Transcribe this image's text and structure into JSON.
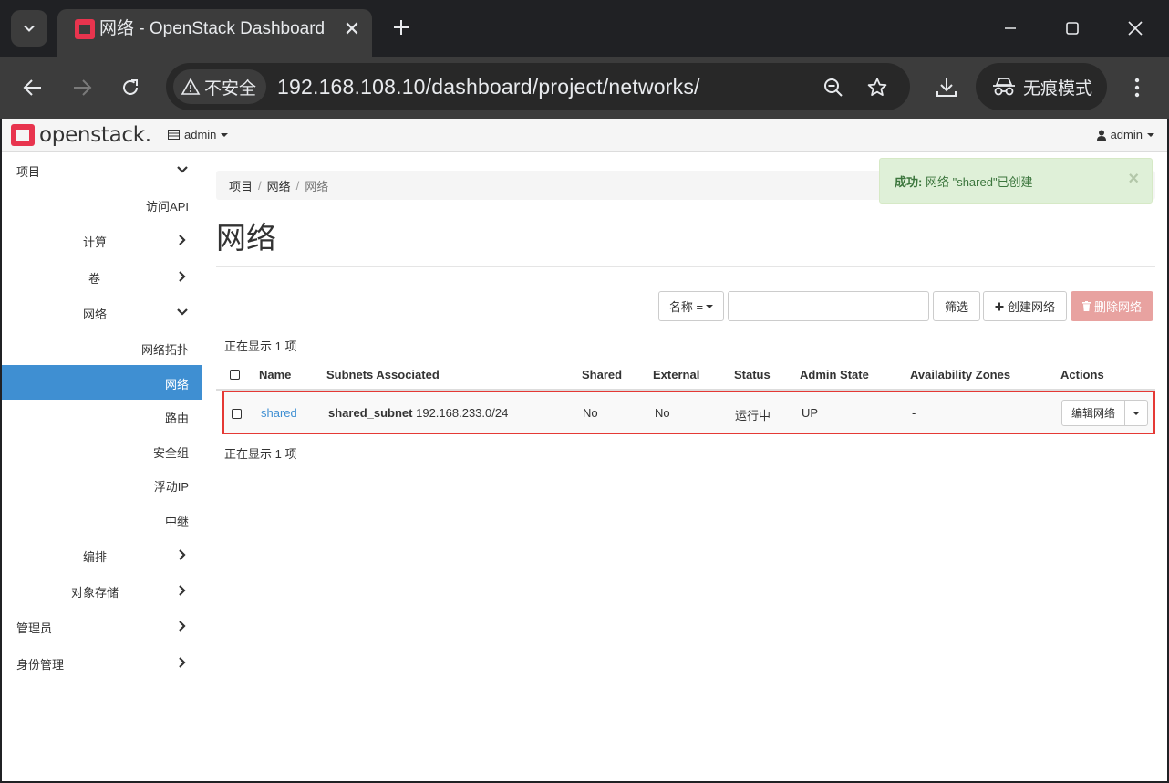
{
  "browser": {
    "tab_title": "网络 - OpenStack Dashboard",
    "security_label": "不安全",
    "url": "192.168.108.10/dashboard/project/networks/",
    "incognito_label": "无痕模式"
  },
  "navbar": {
    "logo_text": "openstack.",
    "project": "admin",
    "user": "admin"
  },
  "sidebar": {
    "items": [
      {
        "label": "项目",
        "level": 0,
        "chevron": "down"
      },
      {
        "label": "访问API",
        "level": 2
      },
      {
        "label": "计算",
        "level": 1,
        "chevron": "right"
      },
      {
        "label": "卷",
        "level": 1,
        "chevron": "right"
      },
      {
        "label": "网络",
        "level": 1,
        "chevron": "down"
      },
      {
        "label": "网络拓扑",
        "level": 2
      },
      {
        "label": "网络",
        "level": 2,
        "active": true
      },
      {
        "label": "路由",
        "level": 2
      },
      {
        "label": "安全组",
        "level": 2
      },
      {
        "label": "浮动IP",
        "level": 2
      },
      {
        "label": "中继",
        "level": 2
      },
      {
        "label": "编排",
        "level": 1,
        "chevron": "right"
      },
      {
        "label": "对象存储",
        "level": 1,
        "chevron": "right"
      },
      {
        "label": "管理员",
        "level": 0,
        "chevron": "right"
      },
      {
        "label": "身份管理",
        "level": 0,
        "chevron": "right"
      }
    ]
  },
  "breadcrumb": [
    "项目",
    "网络",
    "网络"
  ],
  "alert": {
    "strong": "成功:",
    "message": "网络 \"shared\"已创建",
    "close": "×"
  },
  "page_title": "网络",
  "filter": {
    "field_label": "名称 =",
    "input_value": "",
    "filter_button": "筛选",
    "create_button": "创建网络",
    "delete_button": "删除网络"
  },
  "count_text_top": "正在显示 1 项",
  "count_text_bottom": "正在显示 1 项",
  "table": {
    "columns": [
      "Name",
      "Subnets Associated",
      "Shared",
      "External",
      "Status",
      "Admin State",
      "Availability Zones",
      "Actions"
    ],
    "rows": [
      {
        "name": "shared",
        "subnet_name": "shared_subnet",
        "subnet_cidr": "192.168.233.0/24",
        "shared": "No",
        "external": "No",
        "status": "运行中",
        "admin_state": "UP",
        "availability_zones": "-",
        "action_label": "编辑网络"
      }
    ]
  },
  "colors": {
    "accent": "#3f8fd2",
    "danger": "#e8a2a0",
    "success_bg": "#dff0d8",
    "highlight_border": "#e53935"
  }
}
